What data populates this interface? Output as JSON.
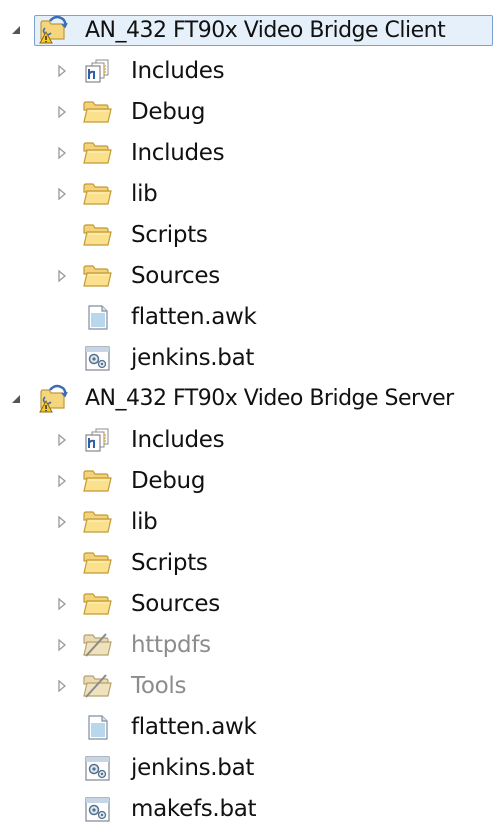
{
  "tree": {
    "projects": [
      {
        "name": "AN_432 FT90x Video Bridge Client",
        "expanded": true,
        "selected": true,
        "icon": "c-project-warning-icon",
        "children": [
          {
            "label": "Includes",
            "icon": "includes-icon",
            "expandable": true,
            "dim": false
          },
          {
            "label": "Debug",
            "icon": "folder-icon",
            "expandable": true,
            "dim": false
          },
          {
            "label": "Includes",
            "icon": "folder-icon",
            "expandable": true,
            "dim": false
          },
          {
            "label": "lib",
            "icon": "folder-icon",
            "expandable": true,
            "dim": false
          },
          {
            "label": "Scripts",
            "icon": "folder-icon",
            "expandable": false,
            "dim": false
          },
          {
            "label": "Sources",
            "icon": "folder-icon",
            "expandable": true,
            "dim": false
          },
          {
            "label": "flatten.awk",
            "icon": "text-file-icon",
            "expandable": false,
            "dim": false
          },
          {
            "label": "jenkins.bat",
            "icon": "bat-file-icon",
            "expandable": false,
            "dim": false
          }
        ]
      },
      {
        "name": "AN_432 FT90x Video Bridge Server",
        "expanded": true,
        "selected": false,
        "icon": "c-project-warning-icon",
        "children": [
          {
            "label": "Includes",
            "icon": "includes-icon",
            "expandable": true,
            "dim": false
          },
          {
            "label": "Debug",
            "icon": "folder-icon",
            "expandable": true,
            "dim": false
          },
          {
            "label": "lib",
            "icon": "folder-icon",
            "expandable": true,
            "dim": false
          },
          {
            "label": "Scripts",
            "icon": "folder-icon",
            "expandable": false,
            "dim": false
          },
          {
            "label": "Sources",
            "icon": "folder-icon",
            "expandable": true,
            "dim": false
          },
          {
            "label": "httpdfs",
            "icon": "excluded-folder-icon",
            "expandable": true,
            "dim": true
          },
          {
            "label": "Tools",
            "icon": "excluded-folder-icon",
            "expandable": true,
            "dim": true
          },
          {
            "label": "flatten.awk",
            "icon": "text-file-icon",
            "expandable": false,
            "dim": false
          },
          {
            "label": "jenkins.bat",
            "icon": "bat-file-icon",
            "expandable": false,
            "dim": false
          },
          {
            "label": "makefs.bat",
            "icon": "bat-file-icon",
            "expandable": false,
            "dim": false
          }
        ]
      }
    ]
  },
  "colors": {
    "folder_fill": "#f6d77a",
    "folder_stroke": "#c9a13b",
    "selection_border": "#7da2ce",
    "selection_fill": "#e6f0fa",
    "dim_text": "#8c8c8c"
  }
}
